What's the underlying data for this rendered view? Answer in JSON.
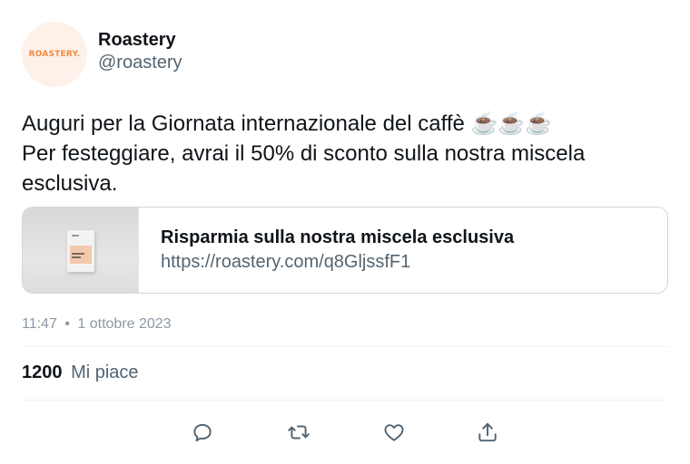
{
  "author": {
    "avatar_text": "ROASTERY.",
    "display_name": "Roastery",
    "handle": "@roastery"
  },
  "tweet": {
    "lines": [
      "Auguri per la Giornata internazionale del caffè ☕☕☕",
      "Per festeggiare, avrai il 50% di sconto sulla nostra miscela",
      "esclusiva."
    ]
  },
  "card": {
    "title": "Risparmia sulla nostra miscela esclusiva",
    "url": "https://roastery.com/q8GljssfF1"
  },
  "meta": {
    "time": "11:47",
    "separator": "•",
    "date": "1 ottobre 2023"
  },
  "stats": {
    "likes_count": "1200",
    "likes_label": "Mi piace"
  },
  "actions": [
    {
      "icon": "reply-icon"
    },
    {
      "icon": "retweet-icon"
    },
    {
      "icon": "like-icon"
    },
    {
      "icon": "share-icon"
    }
  ],
  "colors": {
    "text_primary": "#0f1419",
    "text_secondary": "#536471",
    "avatar_bg": "#fdf1ea",
    "avatar_text": "#f08a3e",
    "border": "#cfd9de"
  }
}
